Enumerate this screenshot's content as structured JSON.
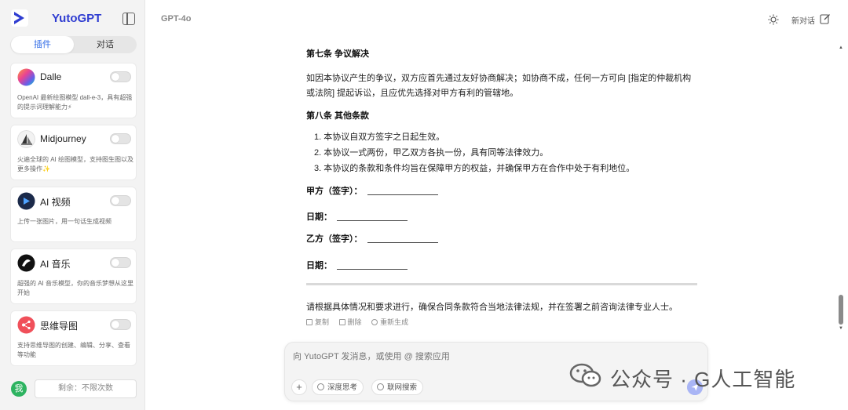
{
  "sidebar": {
    "app_title": "YutoGPT",
    "tabs": [
      {
        "label": "插件",
        "active": true
      },
      {
        "label": "对话",
        "active": false
      }
    ],
    "plugins": [
      {
        "name": "Dalle",
        "desc": "OpenAI 最新绘图模型 dall-e-3，具有超强的提示词理解能力⚡",
        "icon": "dalle-icon",
        "enabled": false
      },
      {
        "name": "Midjourney",
        "desc": "火遍全球的 AI 绘图模型，支持图生图以及更多操作✨",
        "icon": "midjourney-icon",
        "enabled": false
      },
      {
        "name": "AI 视频",
        "desc": "上传一张图片，用一句话生成视频",
        "icon": "ai-video-icon",
        "enabled": false
      },
      {
        "name": "AI 音乐",
        "desc": "超强的 AI 音乐模型，你的音乐梦想从这里开始",
        "icon": "ai-music-icon",
        "enabled": false
      },
      {
        "name": "思维导图",
        "desc": "支持思维导图的创建、编辑、分享、查看等功能",
        "icon": "mindmap-icon",
        "enabled": false
      }
    ],
    "avatar_text": "我",
    "remaining": "剩余：不限次数"
  },
  "header": {
    "model": "GPT-4o",
    "new_chat": "新对话"
  },
  "document": {
    "section7_title": "第七条 争议解决",
    "section7_body": "如因本协议产生的争议，双方应首先通过友好协商解决；如协商不成，任何一方可向 [指定的仲裁机构或法院] 提起诉讼，且应优先选择对甲方有利的管辖地。",
    "section8_title": "第八条 其他条款",
    "section8_items": [
      "1. 本协议自双方签字之日起生效。",
      "2. 本协议一式两份，甲乙双方各执一份，具有同等法律效力。",
      "3. 本协议的条款和条件均旨在保障甲方的权益，并确保甲方在合作中处于有利地位。"
    ],
    "sig_party_a": "甲方（签字）：",
    "sig_date_a": "日期：",
    "sig_party_b": "乙方（签字）：",
    "sig_date_b": "日期：",
    "footer_note": "请根据具体情况和要求进行，确保合同条款符合当地法律法规，并在签署之前咨询法律专业人士。"
  },
  "message_actions": {
    "copy": "复制",
    "delete": "删除",
    "regenerate": "重新生成"
  },
  "composer": {
    "placeholder": "向 YutoGPT 发消息，或使用 @ 搜索应用",
    "deep_think": "深度思考",
    "web_search": "联网搜索"
  },
  "watermark": {
    "text": "公众号 · G人工智能"
  },
  "colors": {
    "brand": "#2f3dd1",
    "active_tab": "#2f6ae6",
    "send": "#a9b5f5",
    "avatar": "#2db360"
  }
}
